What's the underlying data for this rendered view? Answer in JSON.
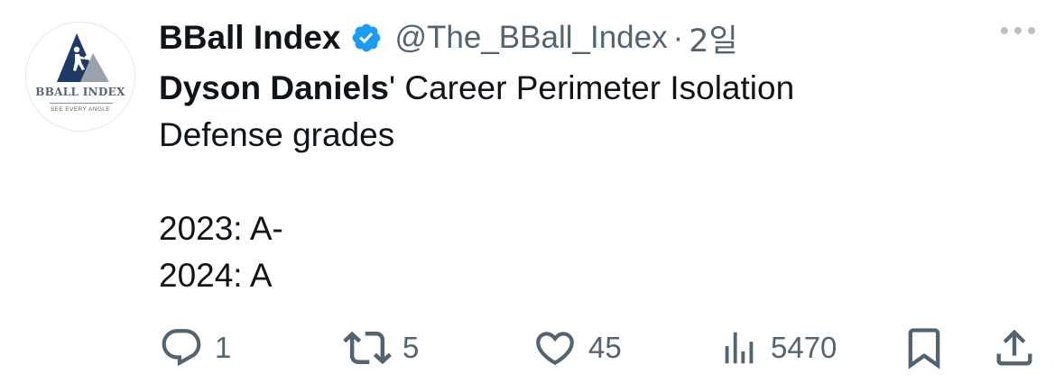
{
  "author": {
    "display_name": "BBall Index",
    "handle": "@The_BBall_Index",
    "separator": "·",
    "time": "2일",
    "avatar": {
      "logo_text": "BBALL INDEX",
      "tagline": "SEE EVERY ANGLE"
    },
    "verified_color": "#1d9bf0"
  },
  "tweet": {
    "bold_name": "Dyson Daniels",
    "line1_rest": "' Career Perimeter Isolation",
    "line2": "Defense grades",
    "line4": "2023: A-",
    "line5": "2024: A"
  },
  "actions": {
    "replies": "1",
    "retweets": "5",
    "likes": "45",
    "views": "5470"
  },
  "icons": [
    "reply-icon",
    "retweet-icon",
    "like-icon",
    "views-icon",
    "bookmark-icon",
    "share-icon",
    "more-icon",
    "verified-badge-icon"
  ],
  "colors": {
    "text": "#0f1419",
    "secondary": "#536471",
    "accent": "#1d9bf0"
  }
}
